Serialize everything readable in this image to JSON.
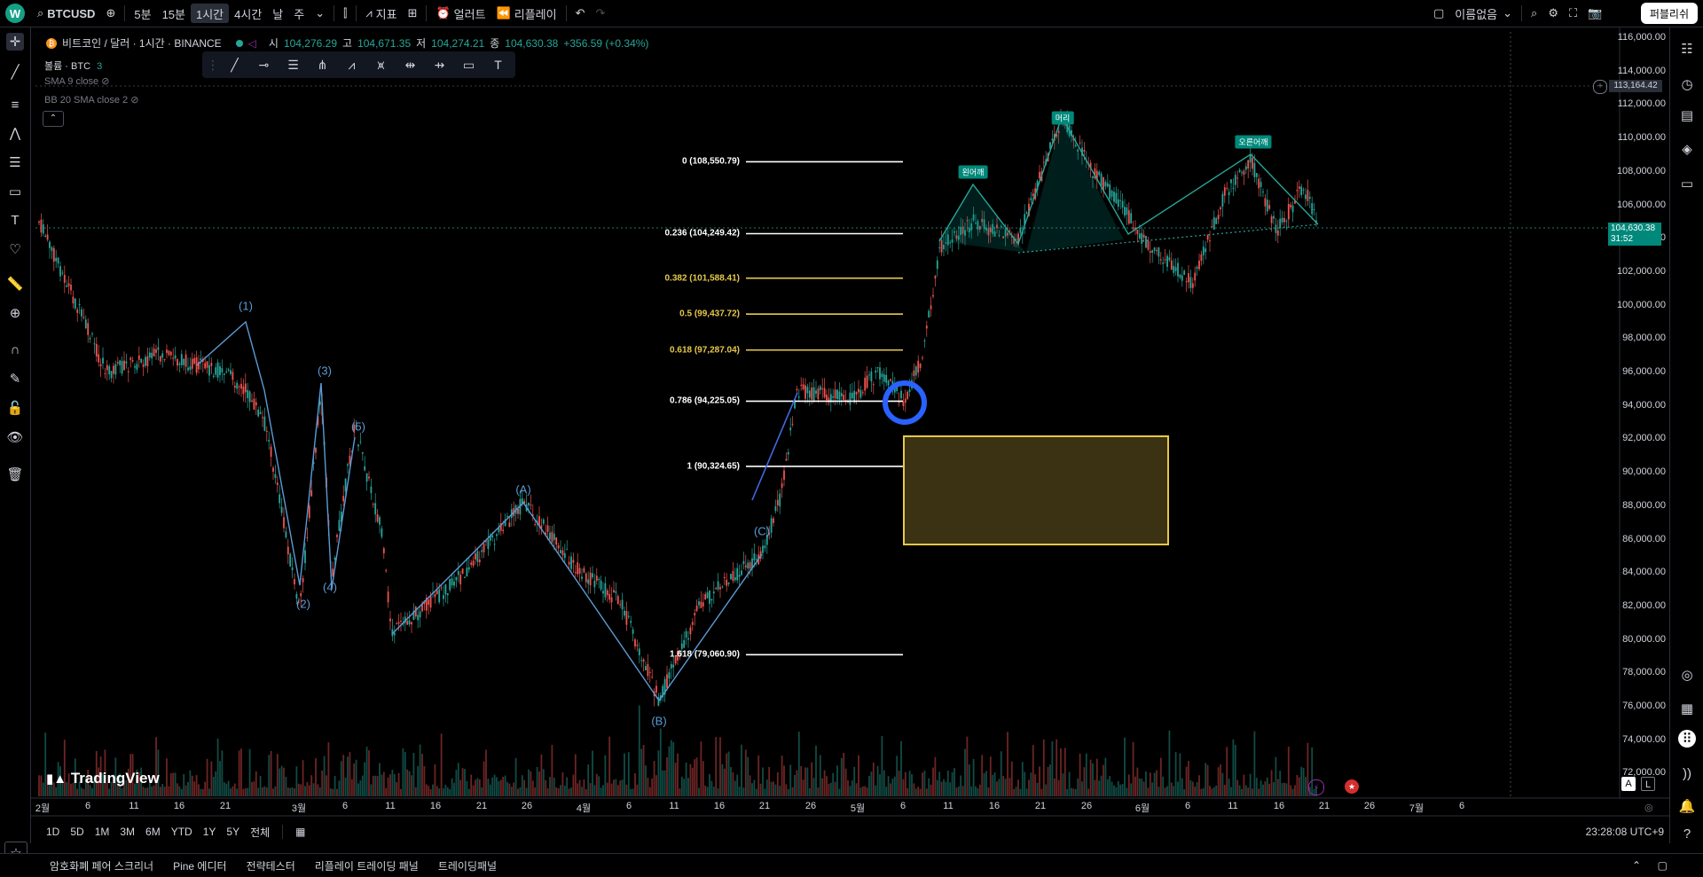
{
  "topbar": {
    "logo_letter": "W",
    "symbol": "BTCUSD",
    "intervals": [
      "5분",
      "15분",
      "1시간",
      "4시간",
      "날",
      "주"
    ],
    "active_interval": "1시간",
    "indicators_label": "지표",
    "alert_label": "얼러트",
    "replay_label": "리플레이",
    "layout_name": "이름없음",
    "publish_label": "퍼블리쉬"
  },
  "legend": {
    "title": "비트코인 / 달러 · 1시간 · BINANCE",
    "open_label": "시",
    "open": "104,276.29",
    "high_label": "고",
    "high": "104,671.35",
    "low_label": "저",
    "low": "104,274.21",
    "close_label": "종",
    "close": "104,630.38",
    "change": "+356.59 (+0.34%)",
    "volume": "볼륨 · BTC",
    "volume_value": "3",
    "sma": "SMA 9 close",
    "bb": "BB 20 SMA close 2"
  },
  "fib_levels": [
    {
      "label": "0 (108,550.79)",
      "price": 108550.79,
      "color": "#ffffff"
    },
    {
      "label": "0.236 (104,249.42)",
      "price": 104249.42,
      "color": "#ffffff"
    },
    {
      "label": "0.382 (101,588.41)",
      "price": 101588.41,
      "color": "#e6c84b"
    },
    {
      "label": "0.5 (99,437.72)",
      "price": 99437.72,
      "color": "#e6c84b"
    },
    {
      "label": "0.618 (97,287.04)",
      "price": 97287.04,
      "color": "#e6c84b"
    },
    {
      "label": "0.786 (94,225.05)",
      "price": 94225.05,
      "color": "#ffffff"
    },
    {
      "label": "1 (90,324.65)",
      "price": 90324.65,
      "color": "#ffffff"
    },
    {
      "label": "1.618 (79,060.90)",
      "price": 79060.9,
      "color": "#ffffff"
    }
  ],
  "waves": [
    "(1)",
    "(2)",
    "(3)",
    "(4)",
    "(5)",
    "(A)",
    "(B)",
    "(C)"
  ],
  "patterns": {
    "left_shoulder": "왼어깨",
    "head": "머리",
    "right_shoulder": "오른어깨"
  },
  "price_axis": [
    "116,000.00",
    "114,000.00",
    "112,000.00",
    "110,000.00",
    "108,000.00",
    "106,000.00",
    "104,000.00",
    "102,000.00",
    "100,000.00",
    "98,000.00",
    "96,000.00",
    "94,000.00",
    "92,000.00",
    "90,000.00",
    "88,000.00",
    "86,000.00",
    "84,000.00",
    "82,000.00",
    "80,000.00",
    "78,000.00",
    "76,000.00",
    "74,000.00",
    "72,000.00"
  ],
  "crosshair_price": "113,164.42",
  "current_price": "104,630.38",
  "countdown": "31:52",
  "time_axis": [
    "2월",
    "6",
    "11",
    "16",
    "21",
    "3월",
    "6",
    "11",
    "16",
    "21",
    "26",
    "4월",
    "6",
    "11",
    "16",
    "21",
    "26",
    "5월",
    "6",
    "11",
    "16",
    "21",
    "26",
    "6월",
    "6",
    "11",
    "16",
    "21",
    "26",
    "7월",
    "6"
  ],
  "ranges": [
    "1D",
    "5D",
    "1M",
    "3M",
    "6M",
    "YTD",
    "1Y",
    "5Y",
    "전체"
  ],
  "clock": "23:28:08 UTC+9",
  "panels": [
    "암호화폐 페어 스크리너",
    "Pine 에디터",
    "전략테스터",
    "리플레이 트레이딩 패널",
    "트레이딩패널"
  ],
  "brand": "TradingView",
  "scale_a": "A",
  "scale_l": "L",
  "colors": {
    "up": "#26a69a",
    "down": "#ef5350",
    "wave": "#5b9bd5",
    "pattern": "#00897b",
    "box": "#e6c84b"
  }
}
